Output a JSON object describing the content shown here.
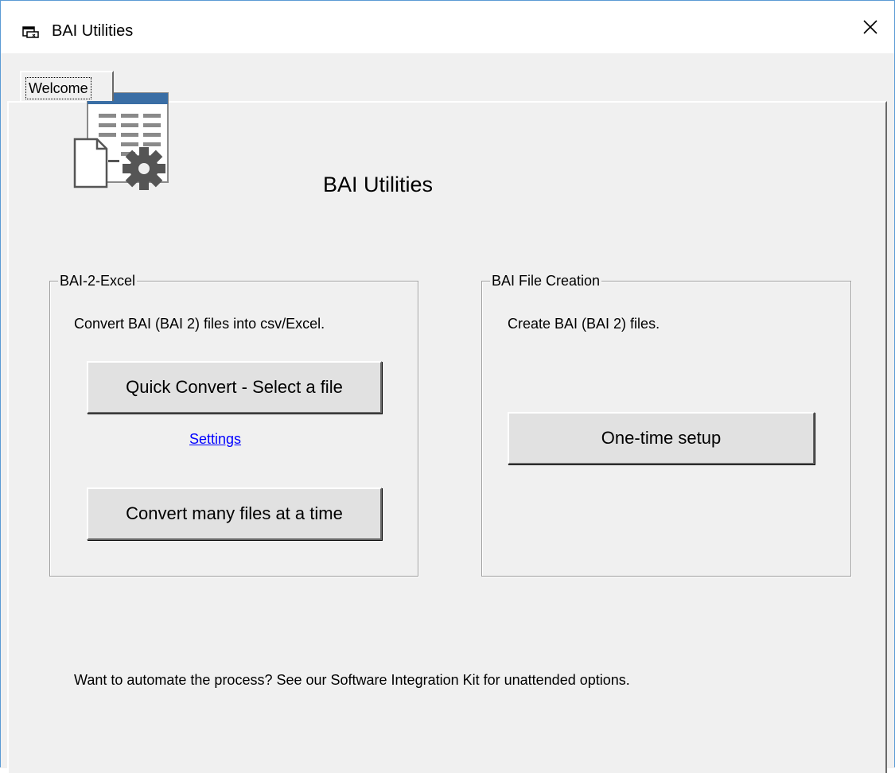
{
  "window": {
    "title": "BAI Utilities",
    "close_glyph": "✕"
  },
  "tabs": [
    {
      "label": "Welcome",
      "selected": true
    }
  ],
  "welcome": {
    "heading": "BAI Utilities",
    "logo_icon": "spreadsheet-gear-icon",
    "footer": "Want to automate the process?  See our Software Integration Kit for unattended options."
  },
  "bai2excel": {
    "title": "BAI-2-Excel",
    "description": "Convert BAI (BAI 2) files into csv/Excel.",
    "quick_convert_label": "Quick Convert - Select a file",
    "settings_link": "Settings",
    "convert_many_label": "Convert many files at a time"
  },
  "file_creation": {
    "title": "BAI File Creation",
    "description": "Create BAI (BAI 2) files.",
    "setup_label": "One-time setup"
  },
  "colors": {
    "window_bg": "#f0f0f0",
    "header_blue": "#3a6ea5",
    "link": "#0000ff",
    "gear": "#555555"
  }
}
